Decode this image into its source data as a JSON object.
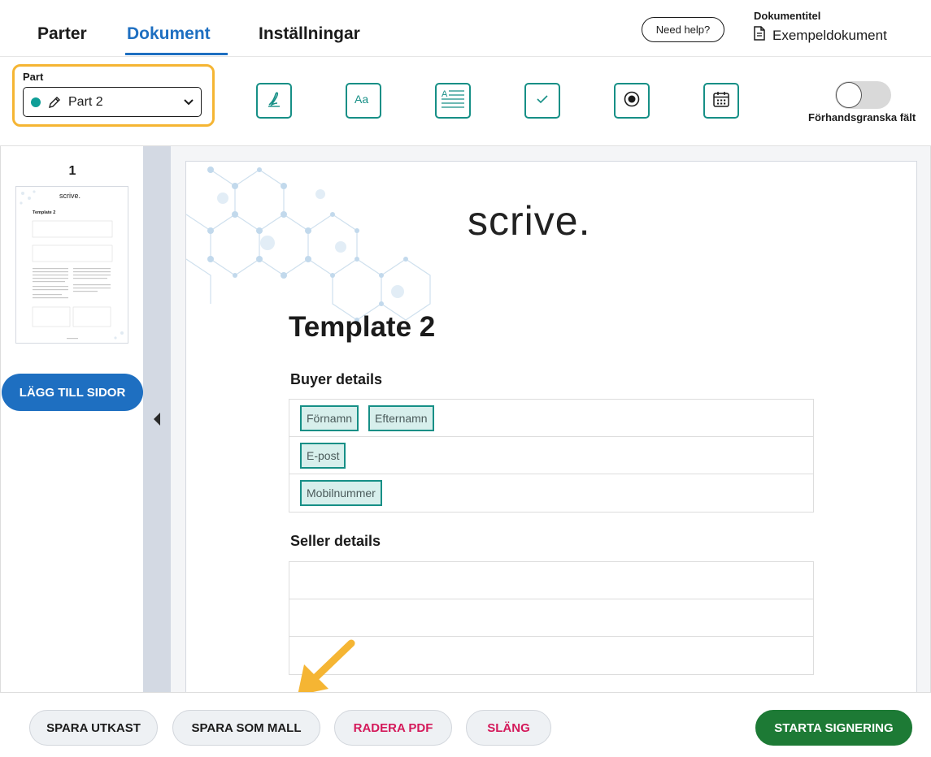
{
  "header": {
    "tabs": [
      {
        "label": "Parter"
      },
      {
        "label": "Dokument"
      },
      {
        "label": "Inställningar"
      }
    ],
    "help_label": "Need help?",
    "doc_title_label": "Dokumentitel",
    "doc_title": "Exempeldokument"
  },
  "toolbar": {
    "party_label": "Part",
    "party_value": "Part 2",
    "party_color": "#0f9e97",
    "field_tools": [
      "signature-icon",
      "text-field-icon",
      "textarea-icon",
      "checkbox-icon",
      "radio-icon",
      "date-icon"
    ],
    "preview_toggle_label": "Förhandsgranska fält",
    "preview_toggle_on": false
  },
  "pages_panel": {
    "page_number": "1",
    "add_pages_label": "LÄGG TILL SIDOR"
  },
  "document": {
    "logo": "scrive.",
    "title": "Template 2",
    "buyer_heading": "Buyer details",
    "buyer_rows": [
      [
        "Förnamn",
        "Efternamn"
      ],
      [
        "E-post"
      ],
      [
        "Mobilnummer"
      ]
    ],
    "seller_heading": "Seller details",
    "seller_rows": [
      [],
      [],
      []
    ]
  },
  "footer": {
    "save_draft": "SPARA UTKAST",
    "save_template": "SPARA SOM MALL",
    "delete_pdf": "RADERA PDF",
    "discard": "SLÄNG",
    "start_signing": "STARTA SIGNERING"
  },
  "colors": {
    "accent": "#1e6fc1",
    "teal": "#168f86",
    "highlight": "#f5b533",
    "danger": "#d4195a",
    "primary": "#1d7a35"
  }
}
